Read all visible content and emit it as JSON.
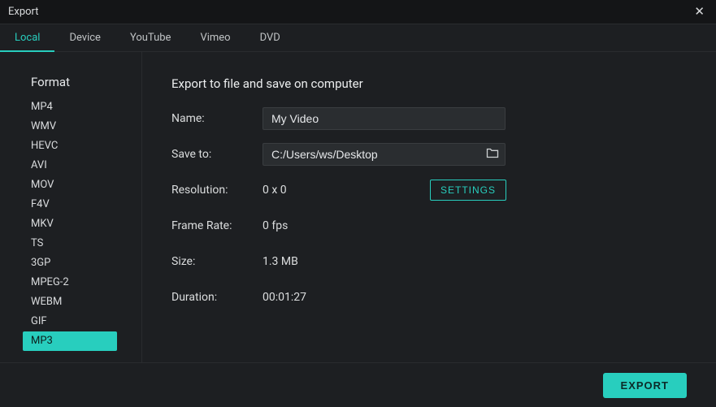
{
  "window": {
    "title": "Export"
  },
  "tabs": {
    "local": "Local",
    "device": "Device",
    "youtube": "YouTube",
    "vimeo": "Vimeo",
    "dvd": "DVD"
  },
  "sidebar": {
    "title": "Format",
    "items": {
      "mp4": "MP4",
      "wmv": "WMV",
      "hevc": "HEVC",
      "avi": "AVI",
      "mov": "MOV",
      "f4v": "F4V",
      "mkv": "MKV",
      "ts": "TS",
      "3gp": "3GP",
      "mpeg2": "MPEG-2",
      "webm": "WEBM",
      "gif": "GIF",
      "mp3": "MP3"
    },
    "selected": "mp3"
  },
  "main": {
    "heading": "Export to file and save on computer",
    "labels": {
      "name": "Name:",
      "saveto": "Save to:",
      "resolution": "Resolution:",
      "framerate": "Frame Rate:",
      "size": "Size:",
      "duration": "Duration:"
    },
    "values": {
      "name": "My Video",
      "saveto": "C:/Users/ws/Desktop",
      "resolution": "0 x 0",
      "framerate": "0 fps",
      "size": "1.3 MB",
      "duration": "00:01:27"
    },
    "buttons": {
      "settings": "SETTINGS",
      "export": "EXPORT"
    }
  }
}
